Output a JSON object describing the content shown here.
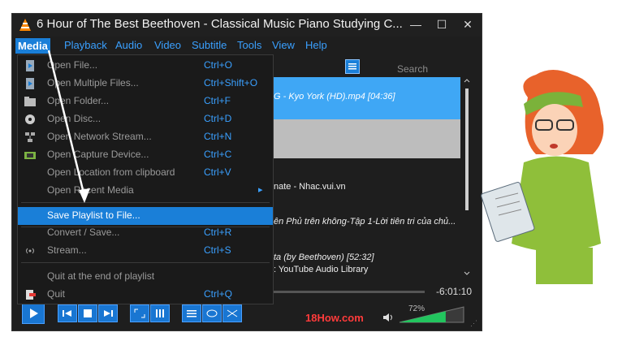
{
  "window": {
    "title": "6 Hour of The Best Beethoven -  Classical Music Piano Studying C...",
    "minimize": "—",
    "maximize": "☐",
    "close": "✕"
  },
  "menubar": [
    "Media",
    "Playback",
    "Audio",
    "Video",
    "Subtitle",
    "Tools",
    "View",
    "Help"
  ],
  "search": {
    "placeholder": "Search"
  },
  "playlist": {
    "rows": [
      "G - Kyo York (HD).mp4 [04:36]",
      "nate - Nhac.vui.vn",
      "ên Phủ trên không-Tập 1-Lời tiên tri của chủ...",
      "ta (by Beethoven) [52:32]",
      ": YouTube Audio Library"
    ]
  },
  "media_menu": {
    "items": [
      {
        "label": "Open File...",
        "shortcut": "Ctrl+O",
        "icon": "file-icon"
      },
      {
        "label": "Open Multiple Files...",
        "shortcut": "Ctrl+Shift+O",
        "icon": "file-icon"
      },
      {
        "label": "Open Folder...",
        "shortcut": "Ctrl+F",
        "icon": "folder-icon"
      },
      {
        "label": "Open Disc...",
        "shortcut": "Ctrl+D",
        "icon": "disc-icon"
      },
      {
        "label": "Open Network Stream...",
        "shortcut": "Ctrl+N",
        "icon": "network-icon"
      },
      {
        "label": "Open Capture Device...",
        "shortcut": "Ctrl+C",
        "icon": "capture-icon"
      },
      {
        "label": "Open Location from clipboard",
        "shortcut": "Ctrl+V",
        "icon": ""
      },
      {
        "label": "Open Recent Media",
        "shortcut": "",
        "icon": ""
      },
      {
        "label": "Save Playlist to File...",
        "shortcut": "",
        "icon": ""
      },
      {
        "label": "Convert / Save...",
        "shortcut": "Ctrl+R",
        "icon": ""
      },
      {
        "label": "Stream...",
        "shortcut": "Ctrl+S",
        "icon": "stream-icon"
      },
      {
        "label": "Quit at the end of playlist",
        "shortcut": "",
        "icon": ""
      },
      {
        "label": "Quit",
        "shortcut": "Ctrl+Q",
        "icon": "quit-icon"
      }
    ],
    "submenu_arrow": "▸"
  },
  "player": {
    "time_remaining": "-6:01:10",
    "volume_percent": "72%",
    "volume_level": 0.72,
    "seek_progress": 0.0
  },
  "watermark": {
    "brand": "18How.com"
  },
  "colors": {
    "accent": "#1a7fd8",
    "menu_text": "#3aa0ff",
    "background": "#1e1e1e",
    "volume_green": "#22c55e"
  }
}
